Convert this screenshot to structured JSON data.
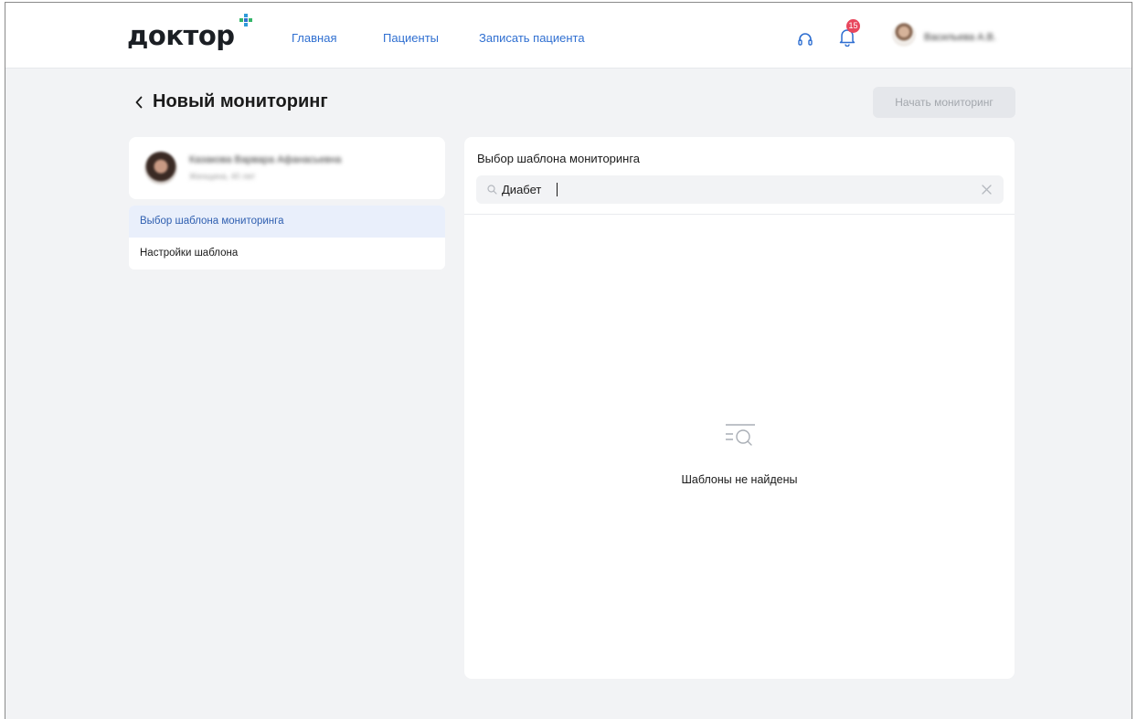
{
  "header": {
    "logo_text": "доктор",
    "nav": {
      "home": "Главная",
      "patients": "Пациенты",
      "record_patient": "Записать пациента"
    },
    "notifications_count": "15",
    "user_name": "Васильева А.В.",
    "accent_color": "#2f6fd1",
    "badge_color": "#e8475d"
  },
  "page": {
    "title": "Новый мониторинг",
    "start_button_label": "Начать мониторинг"
  },
  "patient": {
    "name": "Казакова Варвара Афанасьевна",
    "details": "Женщина, 40 лет"
  },
  "steps": [
    {
      "label": "Выбор шаблона мониторинга",
      "active": true
    },
    {
      "label": "Настройки шаблона",
      "active": false
    }
  ],
  "template_panel": {
    "title": "Выбор шаблона мониторинга",
    "search_value": "Диабет",
    "empty_message": "Шаблоны не найдены"
  },
  "icons": {
    "logo_plus": "plus-icon",
    "support": "headset-icon",
    "notifications": "bell-icon",
    "back": "chevron-left-icon",
    "search": "search-icon",
    "clear": "close-icon",
    "empty": "list-search-icon"
  }
}
